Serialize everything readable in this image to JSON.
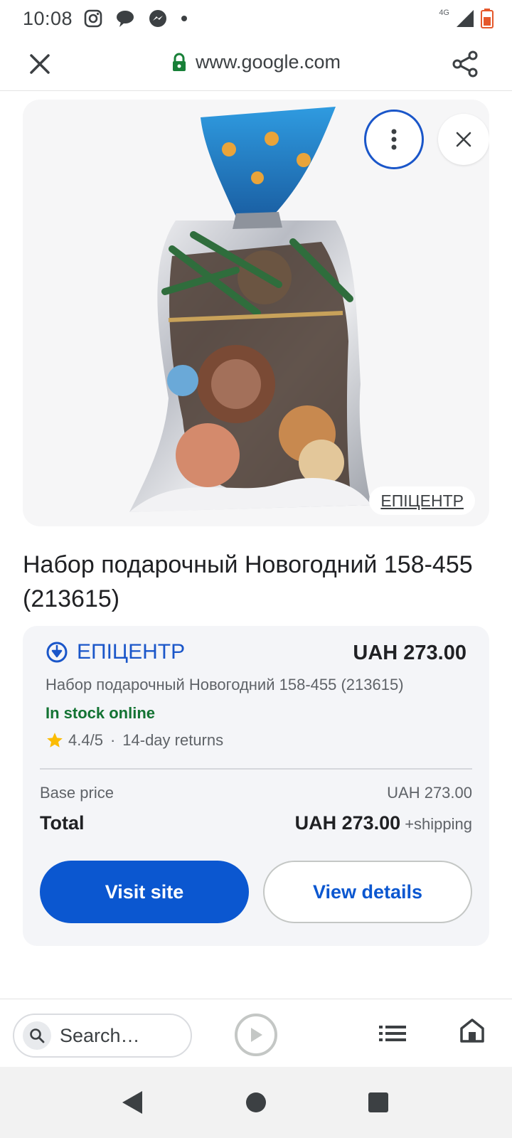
{
  "status_bar": {
    "time": "10:08",
    "network": "4G",
    "icons": [
      "instagram-icon",
      "chat-bubble-icon",
      "messenger-icon",
      "dot-icon",
      "signal-icon",
      "battery-icon"
    ]
  },
  "browser": {
    "url": "www.google.com",
    "icons": [
      "close-icon",
      "lock-icon",
      "share-icon"
    ]
  },
  "image_panel": {
    "store_chip": "ЕПІЦЕНТР",
    "icons": [
      "more-vert-icon",
      "close-icon"
    ]
  },
  "product": {
    "title": "Набор подарочный Новогодний 158-455 (213615)"
  },
  "offer": {
    "merchant": "ЕПІЦЕНТР",
    "price": "UAH 273.00",
    "description": "Набор подарочный Новогодний 158-455 (213615)",
    "stock_status": "In stock online",
    "rating": "4.4/5",
    "separator": "·",
    "returns": "14-day returns",
    "base_price_label": "Base price",
    "base_price_value": "UAH 273.00",
    "total_label": "Total",
    "total_value": "UAH 273.00",
    "shipping": "+shipping",
    "visit_label": "Visit site",
    "details_label": "View details"
  },
  "bottom_bar": {
    "search_placeholder": "Search…",
    "icons": [
      "search-icon",
      "play-icon",
      "list-icon",
      "home-icon"
    ]
  },
  "colors": {
    "accent_blue": "#0b57d0",
    "merchant_blue": "#1a56c9",
    "stock_green": "#137333",
    "star_yellow": "#fbbc04"
  }
}
